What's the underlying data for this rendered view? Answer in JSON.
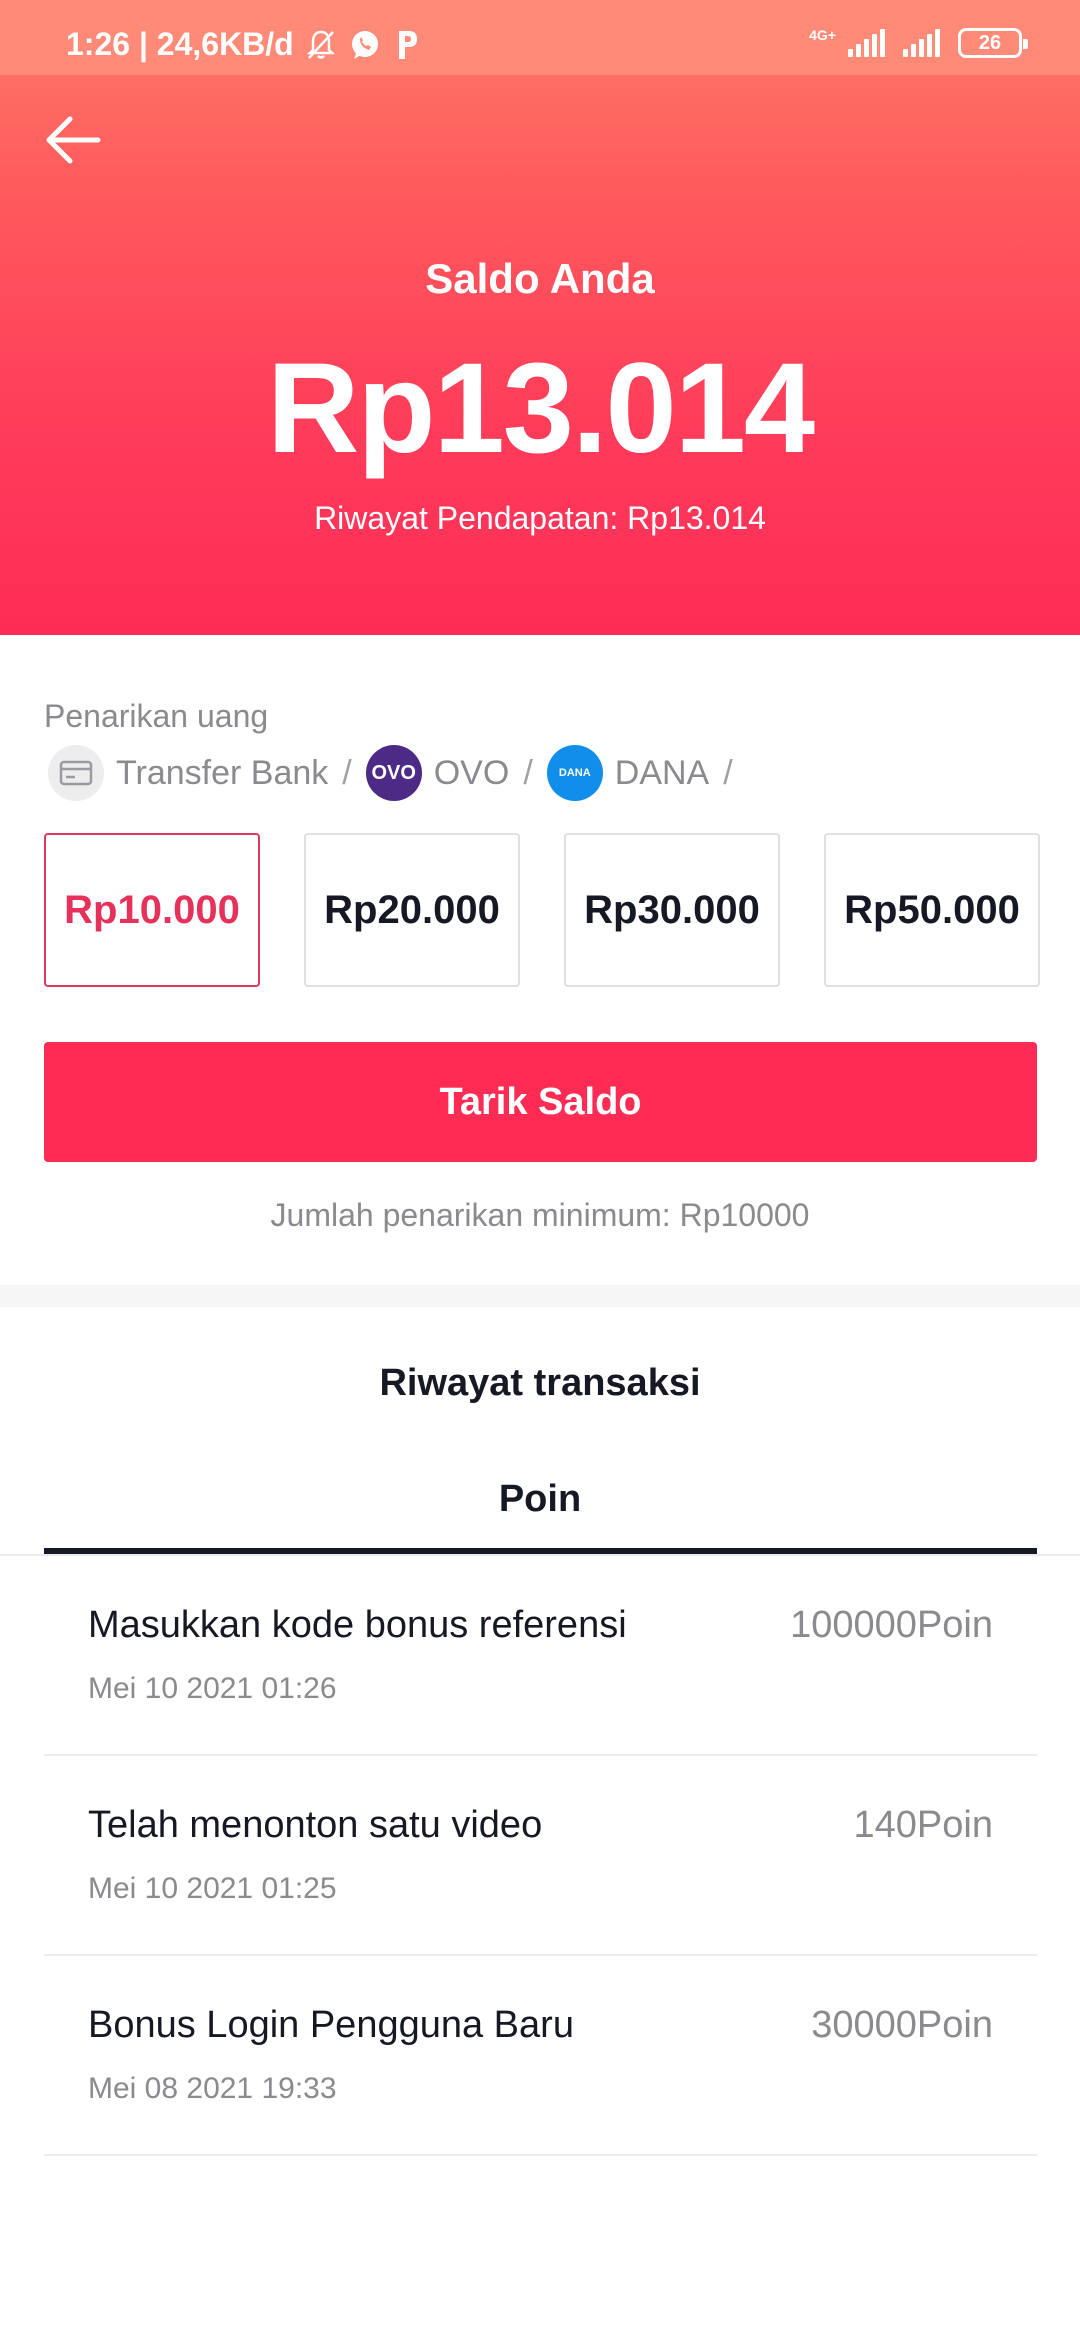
{
  "status_bar": {
    "time_speed": "1:26 | 24,6KB/d",
    "network": "4G+",
    "battery": "26"
  },
  "header": {
    "saldo_label": "Saldo Anda",
    "balance": "Rp13.014",
    "income_history": "Riwayat Pendapatan: Rp13.014"
  },
  "withdraw": {
    "title": "Penarikan uang",
    "methods": [
      {
        "label": "Transfer Bank",
        "icon": "bank-card-icon"
      },
      {
        "label": "OVO",
        "icon": "ovo-logo-icon",
        "icon_text": "OVO"
      },
      {
        "label": "DANA",
        "icon": "dana-logo-icon",
        "icon_text": "DANA"
      }
    ],
    "separator": "/",
    "amounts": [
      "Rp10.000",
      "Rp20.000",
      "Rp30.000",
      "Rp50.000"
    ],
    "selected_index": 0,
    "button_label": "Tarik Saldo",
    "minimum_note": "Jumlah penarikan minimum: Rp10000"
  },
  "transactions": {
    "title": "Riwayat transaksi",
    "tab": "Poin",
    "items": [
      {
        "name": "Masukkan kode bonus referensi",
        "date": "Mei 10 2021 01:26",
        "points": "100000Poin"
      },
      {
        "name": "Telah menonton satu video",
        "date": "Mei 10 2021 01:25",
        "points": "140Poin"
      },
      {
        "name": "Bonus Login Pengguna Baru",
        "date": "Mei 08 2021 19:33",
        "points": "30000Poin"
      }
    ]
  },
  "colors": {
    "accent": "#fe2c55",
    "header_top": "#ff7b69",
    "header_bottom": "#fe2c55",
    "ovo": "#4c2a86",
    "dana": "#118ee9"
  }
}
